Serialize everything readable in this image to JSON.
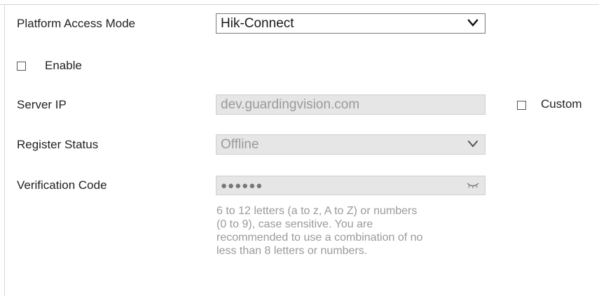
{
  "platform_access_mode": {
    "label": "Platform Access Mode",
    "selected": "Hik-Connect"
  },
  "enable": {
    "label": "Enable",
    "checked": false
  },
  "server_ip": {
    "label": "Server IP",
    "value": "dev.guardingvision.com",
    "custom_label": "Custom",
    "custom_checked": false
  },
  "register_status": {
    "label": "Register Status",
    "selected": "Offline"
  },
  "verification_code": {
    "label": "Verification Code",
    "masked_value": "●●●●●●",
    "hint": "6 to 12 letters (a to z, A to Z) or numbers (0 to 9), case sensitive. You are recommended to use a combination of no less than 8 letters or numbers."
  },
  "colors": {
    "disabled_bg": "#e6e6e6",
    "disabled_text": "#9a9a9a",
    "border_active": "#7a7a7a"
  },
  "icons": {
    "dropdown": "chevron-down-icon",
    "password_visibility": "eye-closed-icon"
  }
}
